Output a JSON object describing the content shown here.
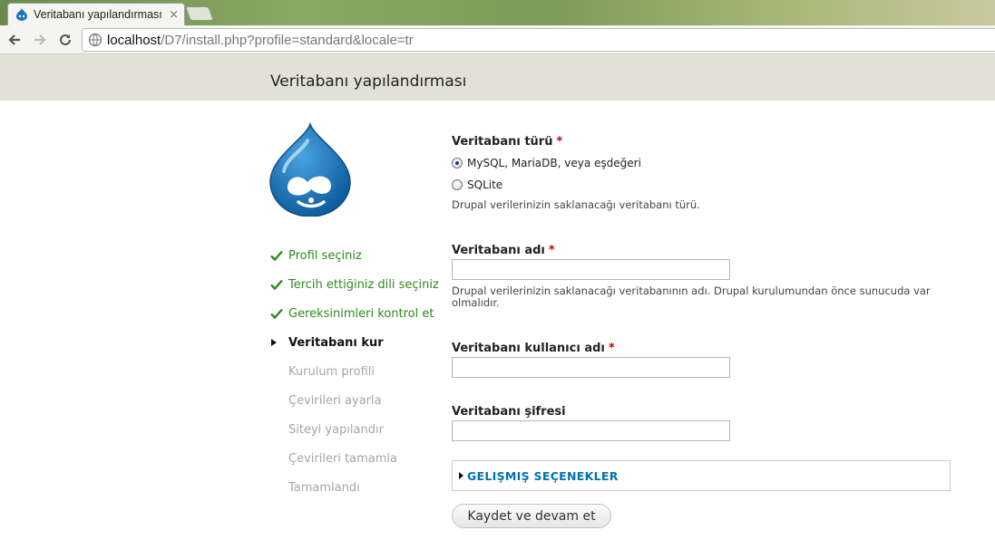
{
  "browser": {
    "tab_title": "Veritabanı yapılandırması | D",
    "tab_close": "×",
    "url_host": "localhost",
    "url_path": "/D7/install.php?profile=standard&locale=tr"
  },
  "header": {
    "title": "Veritabanı yapılandırması"
  },
  "tasks": [
    {
      "label": "Profil seçiniz",
      "state": "done"
    },
    {
      "label": "Tercih ettiğiniz dili seçiniz",
      "state": "done"
    },
    {
      "label": "Gereksinimleri kontrol et",
      "state": "done"
    },
    {
      "label": "Veritabanı kur",
      "state": "active"
    },
    {
      "label": "Kurulum profili",
      "state": "todo"
    },
    {
      "label": "Çevirileri ayarla",
      "state": "todo"
    },
    {
      "label": "Siteyi yapılandır",
      "state": "todo"
    },
    {
      "label": "Çevirileri tamamla",
      "state": "todo"
    },
    {
      "label": "Tamamlandı",
      "state": "todo"
    }
  ],
  "form": {
    "db_type": {
      "label": "Veritabanı türü",
      "required": "*",
      "options": [
        {
          "label": "MySQL, MariaDB, veya eşdeğeri",
          "checked": true
        },
        {
          "label": "SQLite",
          "checked": false
        }
      ],
      "description": "Drupal verilerinizin saklanacağı veritabanı türü."
    },
    "db_name": {
      "label": "Veritabanı adı",
      "required": "*",
      "value": "",
      "description": "Drupal verilerinizin saklanacağı veritabanının adı. Drupal kurulumundan önce sunucuda var olmalıdır."
    },
    "db_user": {
      "label": "Veritabanı kullanıcı adı",
      "required": "*",
      "value": ""
    },
    "db_pass": {
      "label": "Veritabanı şifresi",
      "value": ""
    },
    "advanced": {
      "label": "GELIŞMIŞ SEÇENEKLER"
    },
    "submit": "Kaydet ve devam et"
  },
  "colors": {
    "done": "#2e8a1e",
    "todo": "#a5a5a5",
    "required": "#cc0000",
    "link": "#0071b3",
    "header_bg": "#e2e1d8"
  }
}
